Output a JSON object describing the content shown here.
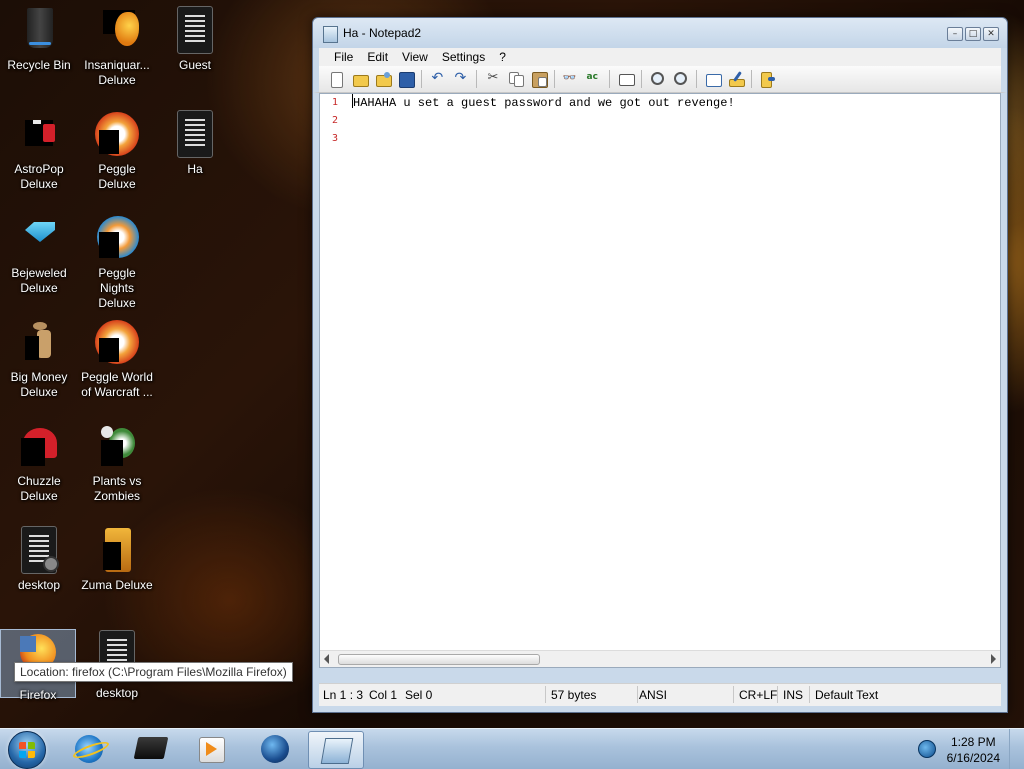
{
  "desktop": {
    "icons": [
      {
        "label": "Recycle Bin",
        "icon": "recycle-bin-icon"
      },
      {
        "label": "Insaniquar... Deluxe",
        "icon": "insaniquarium-icon"
      },
      {
        "label": "Guest",
        "icon": "text-document-icon"
      },
      {
        "label": "AstroPop Deluxe",
        "icon": "astropop-icon"
      },
      {
        "label": "Peggle Deluxe",
        "icon": "peggle-icon"
      },
      {
        "label": "Ha",
        "icon": "text-document-icon"
      },
      {
        "label": "Bejeweled Deluxe",
        "icon": "bejeweled-icon"
      },
      {
        "label": "Peggle Nights Deluxe",
        "icon": "peggle-nights-icon"
      },
      {
        "label": "Big Money Deluxe",
        "icon": "big-money-icon"
      },
      {
        "label": "Peggle World of Warcraft ...",
        "icon": "peggle-wow-icon"
      },
      {
        "label": "Chuzzle Deluxe",
        "icon": "chuzzle-icon"
      },
      {
        "label": "Plants vs Zombies",
        "icon": "plants-vs-zombies-icon"
      },
      {
        "label": "desktop",
        "icon": "settings-document-icon"
      },
      {
        "label": "Zuma Deluxe",
        "icon": "zuma-icon"
      },
      {
        "label": "Firefox",
        "icon": "firefox-icon"
      },
      {
        "label": "desktop",
        "icon": "text-document-icon"
      }
    ]
  },
  "tooltip": {
    "text": "Location: firefox (C:\\Program Files\\Mozilla Firefox)"
  },
  "window": {
    "title": "Ha - Notepad2",
    "menu": [
      "File",
      "Edit",
      "View",
      "Settings",
      "?"
    ],
    "toolbar": [
      "new-icon",
      "open-icon",
      "browse-icon",
      "save-icon",
      "undo-icon",
      "redo-icon",
      "cut-icon",
      "copy-icon",
      "paste-icon",
      "find-icon",
      "replace-icon",
      "word-wrap-icon",
      "zoom-in-icon",
      "zoom-out-icon",
      "schemes-icon",
      "customize-schemes-icon",
      "exit-icon"
    ],
    "editor": {
      "line_numbers": [
        "1",
        "2",
        "3"
      ],
      "lines": [
        "HAHAHA u set a guest password and we got out revenge!",
        "",
        ""
      ]
    },
    "status": {
      "position": "Ln 1 : 3",
      "column": "Col 1",
      "selection": "Sel 0",
      "size": "57 bytes",
      "encoding": "ANSI",
      "line_endings": "CR+LF",
      "mode": "INS",
      "scheme": "Default Text"
    }
  },
  "taskbar": {
    "apps": [
      "internet-explorer-icon",
      "media-center-icon",
      "media-player-icon",
      "globe-icon",
      "notepad2-icon"
    ],
    "clock": {
      "time": "1:28 PM",
      "date": "6/16/2024"
    }
  },
  "colors": {
    "line_number": "#c62828",
    "taskbar": "#a9c2dc",
    "title_bar": "#c3d5e8"
  }
}
